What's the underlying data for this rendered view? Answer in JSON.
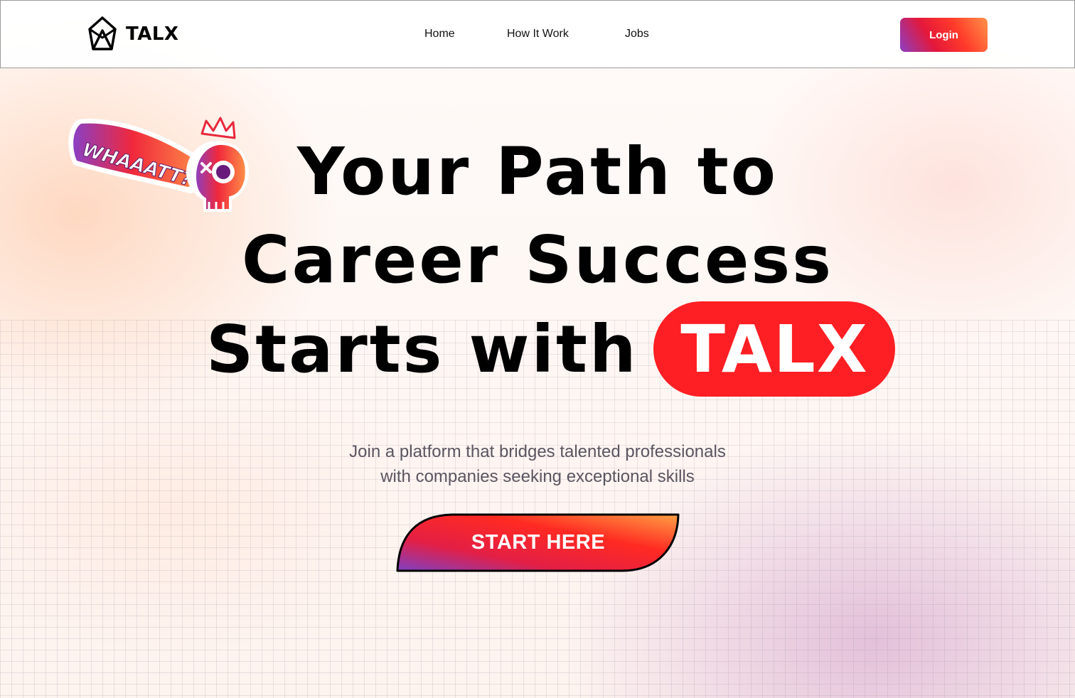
{
  "nav": {
    "brand": "TALX",
    "links": [
      "Home",
      "How It Work",
      "Jobs"
    ],
    "login_label": "Login"
  },
  "hero": {
    "sticker_text": "WHAAATT???",
    "headline_line1": "Your Path to",
    "headline_line2": "Career Success",
    "headline_line3": "Starts with",
    "headline_highlight": "TALX",
    "subtitle_line1": "Join a platform that bridges talented professionals",
    "subtitle_line2": "with companies seeking exceptional skills",
    "cta_label": "START HERE"
  },
  "colors": {
    "accent_red": "#fe1f24",
    "gradient_purple": "#8a3fc4",
    "gradient_orange": "#ff9248"
  },
  "icons": {
    "logo": "talx-logo-icon",
    "sticker": "skull-crown-sticker"
  }
}
